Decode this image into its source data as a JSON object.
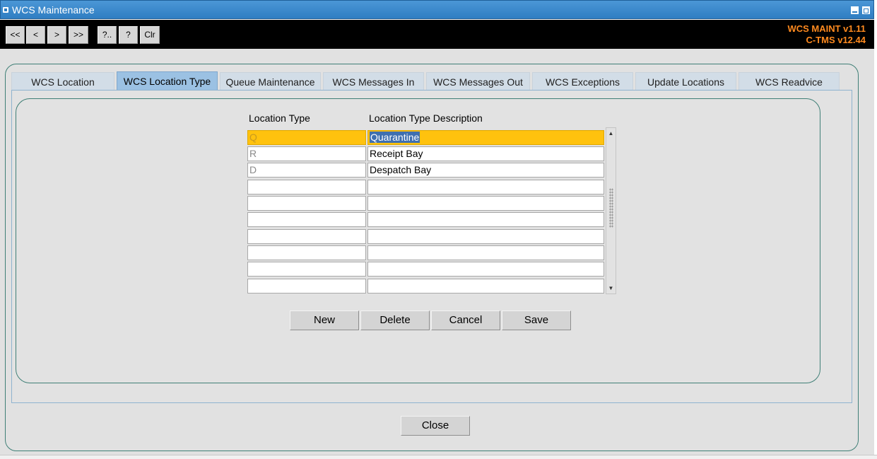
{
  "window": {
    "title": "WCS Maintenance"
  },
  "toolbar": {
    "buttons": [
      "<<",
      "<",
      ">",
      ">>",
      "?..",
      "?",
      "Clr"
    ],
    "version_line_1": "WCS  MAINT v1.11",
    "version_line_2": "C-TMS v12.44"
  },
  "tabs": [
    {
      "label": "WCS Location",
      "active": false
    },
    {
      "label": "WCS Location Type",
      "active": true
    },
    {
      "label": "Queue Maintenance",
      "active": false
    },
    {
      "label": "WCS Messages In",
      "active": false
    },
    {
      "label": "WCS Messages Out",
      "active": false
    },
    {
      "label": "WCS Exceptions",
      "active": false
    },
    {
      "label": "Update Locations",
      "active": false
    },
    {
      "label": "WCS Readvice",
      "active": false
    }
  ],
  "grid": {
    "headers": {
      "location_type": "Location Type",
      "description": "Location Type Description"
    },
    "rows": [
      {
        "code": "Q",
        "description": "Quarantine",
        "selected": true
      },
      {
        "code": "R",
        "description": "Receipt Bay",
        "selected": false
      },
      {
        "code": "D",
        "description": "Despatch Bay",
        "selected": false
      },
      {
        "code": "",
        "description": "",
        "selected": false
      },
      {
        "code": "",
        "description": "",
        "selected": false
      },
      {
        "code": "",
        "description": "",
        "selected": false
      },
      {
        "code": "",
        "description": "",
        "selected": false
      },
      {
        "code": "",
        "description": "",
        "selected": false
      },
      {
        "code": "",
        "description": "",
        "selected": false
      },
      {
        "code": "",
        "description": "",
        "selected": false
      }
    ]
  },
  "actions": {
    "new_label": "New",
    "delete_label": "Delete",
    "cancel_label": "Cancel",
    "save_label": "Save"
  },
  "footer": {
    "close_label": "Close"
  },
  "colors": {
    "titlebar": "#2f7ec2",
    "version_text": "#ff8a1f",
    "selected_row": "#ffc20e",
    "active_tab": "#9bc1e3",
    "panel_border": "#3f7f76"
  }
}
